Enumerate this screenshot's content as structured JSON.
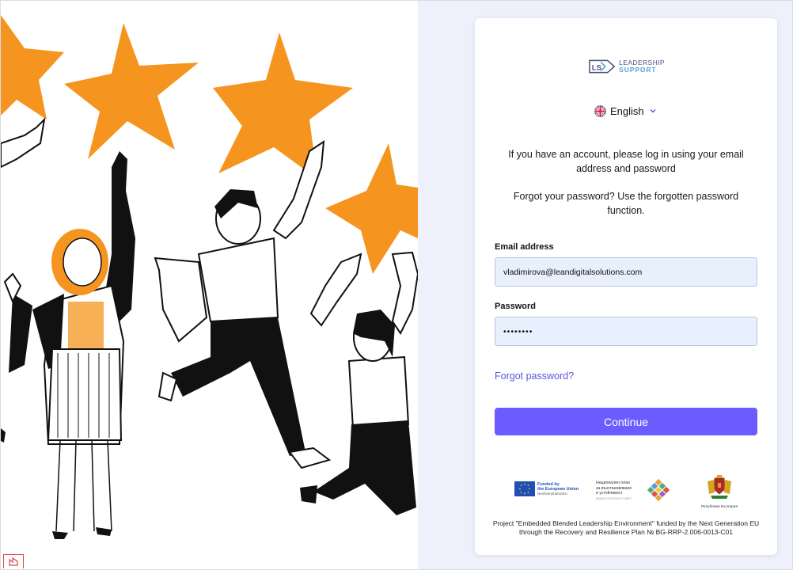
{
  "brand": {
    "logo_mark": "LS",
    "line1": "LEADERSHIP",
    "line2": "SUPPORT"
  },
  "language": {
    "selected": "English",
    "flag_icon": "uk-flag-icon"
  },
  "intro": {
    "login_hint": "If you have an account, please log in using your email address and password",
    "forgot_hint": "Forgot your password? Use the forgotten password function."
  },
  "form": {
    "email_label": "Email address",
    "email_value": "vladimirova@leandigitalsolutions.com",
    "password_label": "Password",
    "password_value": "••••••••",
    "forgot_link": "Forgot password?",
    "submit_label": "Continue"
  },
  "funders": {
    "eu_line1": "Funded by",
    "eu_line2": "the European Union",
    "eu_line3": "NextGenerationEU",
    "nprp_line1": "Национален план",
    "nprp_line2": "за възстановяване",
    "nprp_line3": "и устойчивост",
    "nprp_line4": "МИНИСТЕРСКИ СЪВЕТ",
    "coat_caption": "Република България"
  },
  "footer": {
    "project_text": "Project \"Embedded Blended Leadership Environment\" funded by the Next Generation EU through the Recovery and Resilience Plan № BG-RRP-2.006-0013-C01"
  },
  "colors": {
    "accent": "#6a5cff",
    "link": "#5b55e0",
    "star": "#f5951f",
    "panel_bg": "#eef0fb",
    "input_bg": "#e8effd"
  }
}
